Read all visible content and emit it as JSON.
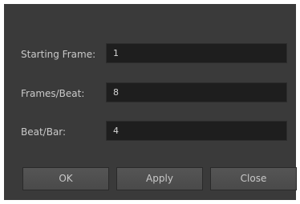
{
  "fields": [
    {
      "label": "Starting Frame:",
      "value": "1"
    },
    {
      "label": "Frames/Beat:",
      "value": "8"
    },
    {
      "label": "Beat/Bar:",
      "value": "4"
    }
  ],
  "buttons": {
    "ok": "OK",
    "apply": "Apply",
    "close": "Close"
  },
  "colors": {
    "dialog_background": "#3a3a3a",
    "field_background": "#1e1e1e",
    "button_background": "#4f4f4f",
    "text": "#c9c9c9"
  }
}
